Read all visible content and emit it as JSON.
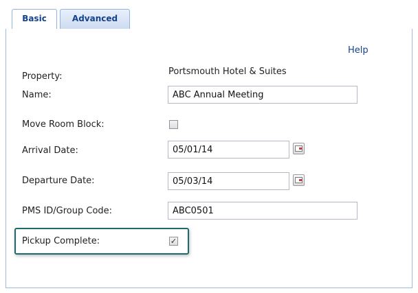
{
  "tabs": [
    {
      "label": "Basic",
      "active": true
    },
    {
      "label": "Advanced",
      "active": false
    }
  ],
  "help_label": "Help",
  "form": {
    "property_label": "Property:",
    "property_value": "Portsmouth Hotel & Suites",
    "name_label": "Name:",
    "name_value": "ABC Annual Meeting",
    "move_room_block_label": "Move Room Block:",
    "move_room_block_checked": false,
    "arrival_label": "Arrival Date:",
    "arrival_value": "05/01/14",
    "departure_label": "Departure Date:",
    "departure_value": "05/03/14",
    "pms_label": "PMS ID/Group Code:",
    "pms_value": "ABC0501",
    "pickup_label": "Pickup Complete:",
    "pickup_checked": true
  },
  "colors": {
    "tab_text": "#15428b",
    "border": "#99bbe8",
    "highlight": "#1a6b6b"
  },
  "icons": {
    "date_picker": "calendar-icon",
    "checkmark": "✓"
  }
}
